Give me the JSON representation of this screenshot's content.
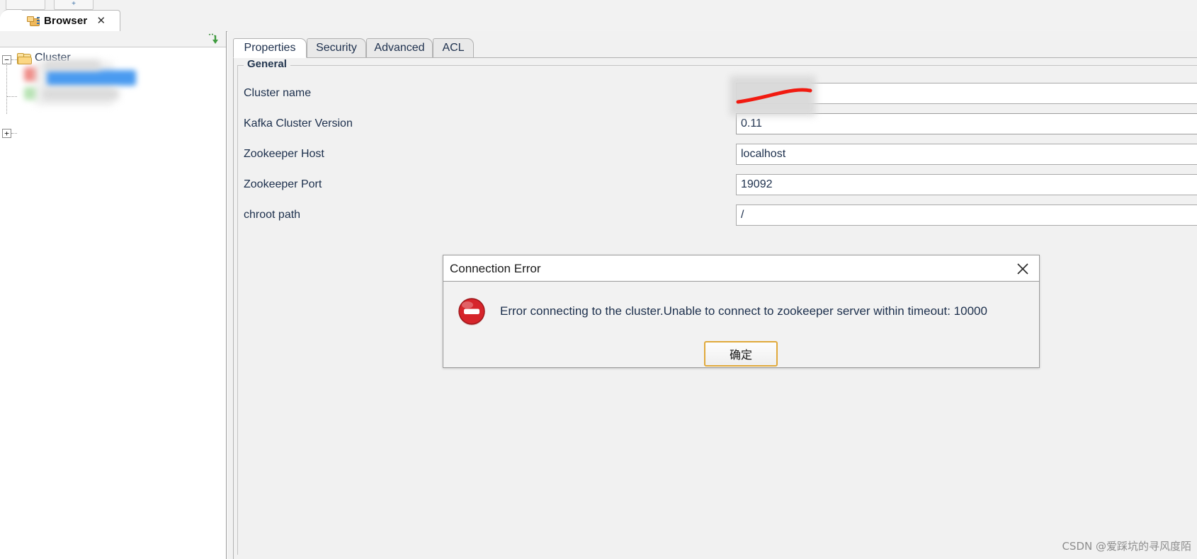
{
  "toolbar": {
    "button1_label": "",
    "button2_label": "+"
  },
  "view_tab": {
    "title": "Browser",
    "close_label": "✕",
    "icon": "browser-folders-icon"
  },
  "left_panel": {
    "refresh_icon": "refresh-down-arrow-icon",
    "tree": {
      "root": {
        "label": "Cluster",
        "expander": "−",
        "icon": "folder-icon",
        "redacted": true
      },
      "children": [
        {
          "label": "",
          "expander": "",
          "redacted": true,
          "state": "selected"
        },
        {
          "label": "",
          "expander": "+",
          "redacted": true,
          "state": "collapsed"
        }
      ]
    }
  },
  "editor": {
    "tabs": [
      {
        "label": "Properties",
        "active": true
      },
      {
        "label": "Security",
        "active": false
      },
      {
        "label": "Advanced",
        "active": false
      },
      {
        "label": "ACL",
        "active": false
      }
    ],
    "group_title": "General",
    "fields": [
      {
        "label": "Cluster name",
        "value": "",
        "redacted": true,
        "type": "text"
      },
      {
        "label": "Kafka Cluster Version",
        "value": "0.11",
        "redacted": false,
        "type": "combo"
      },
      {
        "label": "Zookeeper Host",
        "value": "localhost",
        "redacted": false,
        "type": "text"
      },
      {
        "label": "Zookeeper Port",
        "value": "19092",
        "redacted": false,
        "type": "text"
      },
      {
        "label": "chroot path",
        "value": "/",
        "redacted": false,
        "type": "text"
      }
    ]
  },
  "dialog": {
    "title": "Connection Error",
    "close_label": "✕",
    "icon": "error-stop-icon",
    "message": "Error connecting to the cluster.Unable to connect to zookeeper server within timeout: 10000",
    "ok_button": "确定"
  },
  "watermark": {
    "text": "CSDN @爱踩坑的寻风度陌"
  },
  "colors": {
    "accent_blue": "#4a9bf0",
    "error_red": "#d6252b",
    "focus_gold": "#e0a93b",
    "label_text": "#1c2f4c",
    "panel_bg": "#f1f1f1"
  }
}
